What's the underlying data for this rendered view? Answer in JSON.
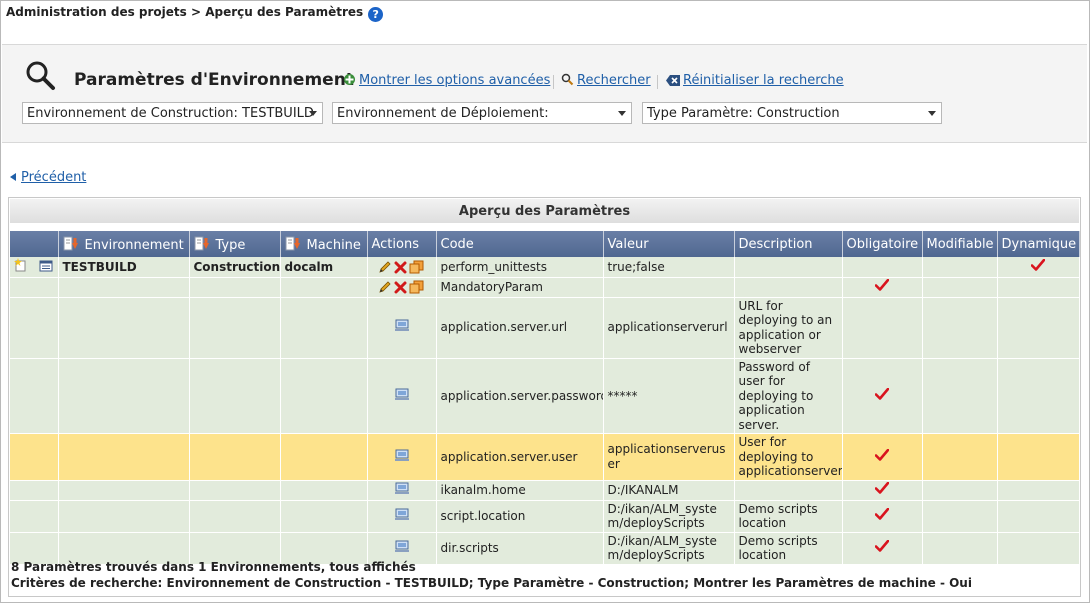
{
  "breadcrumb": "Administration des projets > Aperçu des Paramètres",
  "search": {
    "title": "Paramètres d'Environnement",
    "advanced_label": "Montrer les options avancées",
    "search_label": "Rechercher",
    "reset_label": "Réinitialiser la recherche",
    "build_env_select": "Environnement de Construction: TESTBUILD",
    "deploy_env_select": "Environnement de Déploiement:",
    "param_type_select": "Type Paramètre: Construction"
  },
  "nav": {
    "previous_label": "Précédent"
  },
  "panel": {
    "title": "Aperçu des Paramètres"
  },
  "table": {
    "headers": {
      "environment": "Environnement",
      "type": "Type",
      "machine": "Machine",
      "actions": "Actions",
      "code": "Code",
      "value": "Valeur",
      "description": "Description",
      "mandatory": "Obligatoire",
      "modifiable": "Modifiable",
      "dynamic": "Dynamique"
    },
    "group": {
      "environment": "TESTBUILD",
      "type": "Construction",
      "machine": "docalm"
    },
    "rows": [
      {
        "code": "perform_unittests",
        "value": "true;false",
        "description": "",
        "mandatory": false,
        "modifiable": false,
        "dynamic": true
      },
      {
        "code": "MandatoryParam",
        "value": "",
        "description": "",
        "mandatory": true,
        "modifiable": false,
        "dynamic": false
      },
      {
        "code": "application.server.url",
        "value": "applicationserverurl",
        "description": "URL for deploying to an application or webserver",
        "mandatory": false,
        "modifiable": false,
        "dynamic": false
      },
      {
        "code": "application.server.password",
        "value": "*****",
        "description": "Password of user for deploying to application server.",
        "mandatory": true,
        "modifiable": false,
        "dynamic": false
      },
      {
        "code": "application.server.user",
        "value": "applicationserveruser",
        "description": "User for deploying to applicationserver",
        "mandatory": true,
        "modifiable": false,
        "dynamic": false
      },
      {
        "code": "ikanalm.home",
        "value": "D:/IKANALM",
        "description": "",
        "mandatory": true,
        "modifiable": false,
        "dynamic": false
      },
      {
        "code": "script.location",
        "value": "D:/ikan/ALM_system/deployScripts",
        "description": "Demo scripts location",
        "mandatory": true,
        "modifiable": false,
        "dynamic": false
      },
      {
        "code": "dir.scripts",
        "value": "D:/ikan/ALM_system/deployScripts",
        "description": "Demo scripts location",
        "mandatory": true,
        "modifiable": false,
        "dynamic": false
      }
    ]
  },
  "footer": {
    "count_text": "8 Paramètres trouvés dans 1 Environnements, tous affichés",
    "criteria_text": "Critères de recherche: Environnement de Construction - TESTBUILD; Type Paramètre - Construction; Montrer les Paramètres de machine - Oui"
  },
  "colors": {
    "header_bg": "#5a6f99",
    "row_green": "#e2ebdc",
    "row_highlight": "#fde38c",
    "link": "#1f5fa8",
    "check_red": "#d9141e"
  }
}
